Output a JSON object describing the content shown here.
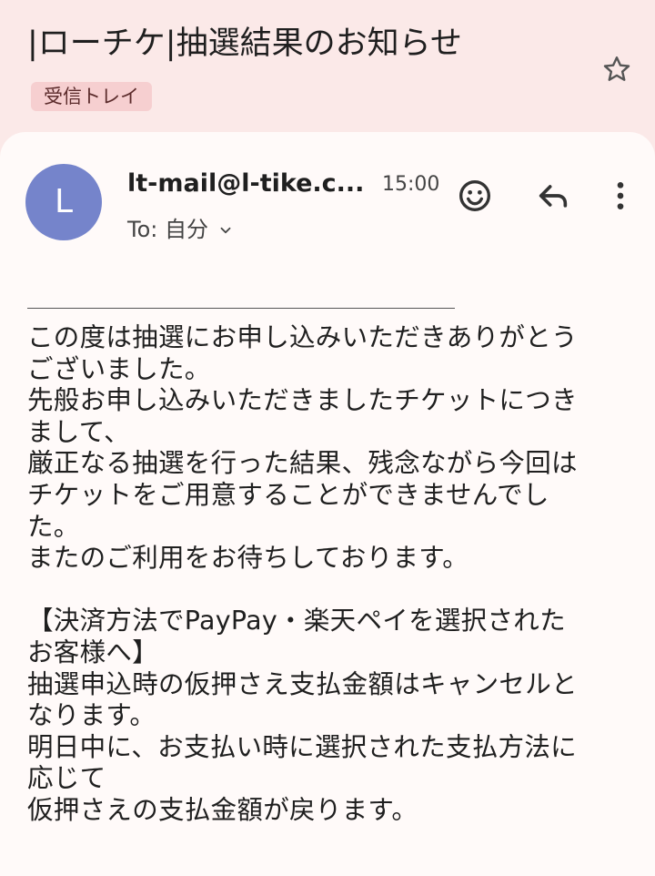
{
  "email": {
    "subject": "|ローチケ|抽選結果のお知らせ",
    "label": "受信トレイ",
    "sender_initial": "L",
    "sender": "lt-mail@l-tike.c...",
    "time": "15:00",
    "to_line": "To: 自分",
    "body_lines": [
      "この度は抽選にお申し込みいただきありがとう",
      "ございました。",
      "先般お申し込みいただきましたチケットにつき",
      "まして、",
      "厳正なる抽選を行った結果、残念ながら今回は",
      "チケットをご用意することができませんでし",
      "た。",
      "またのご利用をお待ちしております。",
      "",
      "【決済方法でPayPay・楽天ペイを選択された",
      "お客様へ】",
      "抽選申込時の仮押さえ支払金額はキャンセルと",
      "なります。",
      "明日中に、お支払い時に選択された支払方法に",
      "応じて",
      "仮押さえの支払金額が戻ります。"
    ]
  },
  "icons": {
    "star": "star-icon",
    "emoji": "emoji-icon",
    "reply": "reply-icon",
    "more": "more-vert-icon",
    "chevron": "chevron-down-icon"
  },
  "colors": {
    "background": "#fbe9e8",
    "card": "#fffaf9",
    "avatar": "#7584cb",
    "label_chip": "#f6cfd0"
  }
}
